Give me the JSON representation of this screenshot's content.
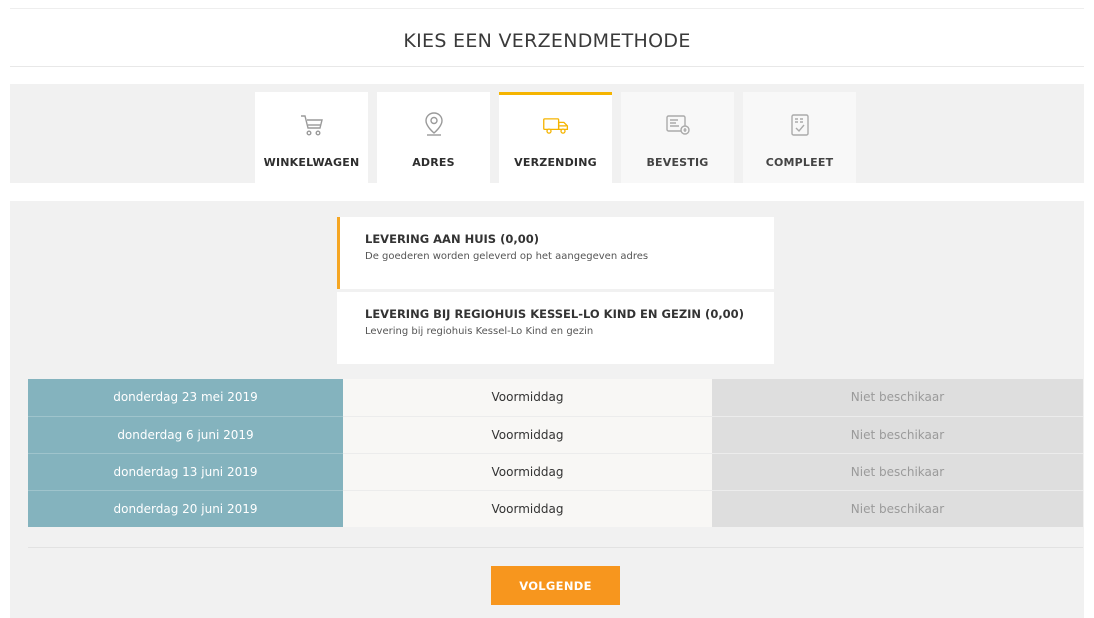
{
  "page": {
    "title": "KIES EEN VERZENDMETHODE"
  },
  "steps": [
    {
      "label": "WINKELWAGEN",
      "icon": "cart-icon",
      "state": "done"
    },
    {
      "label": "ADRES",
      "icon": "location-pin-icon",
      "state": "done"
    },
    {
      "label": "VERZENDING",
      "icon": "truck-icon",
      "state": "active"
    },
    {
      "label": "BEVESTIG",
      "icon": "payment-card-icon",
      "state": "upcoming"
    },
    {
      "label": "COMPLEET",
      "icon": "checklist-icon",
      "state": "upcoming"
    }
  ],
  "shipping_options": [
    {
      "title": "LEVERING AAN HUIS (0,00)",
      "description": "De goederen worden geleverd op het aangegeven adres",
      "selected": true
    },
    {
      "title": "LEVERING BIJ REGIOHUIS KESSEL-LO KIND EN GEZIN (0,00)",
      "description": "Levering bij regiohuis Kessel-Lo Kind en gezin",
      "selected": false
    }
  ],
  "delivery_slots": [
    {
      "date": "donderdag 23 mei 2019",
      "time": "Voormiddag",
      "status": "Niet beschikaar"
    },
    {
      "date": "donderdag 6 juni 2019",
      "time": "Voormiddag",
      "status": "Niet beschikaar"
    },
    {
      "date": "donderdag 13 juni 2019",
      "time": "Voormiddag",
      "status": "Niet beschikaar"
    },
    {
      "date": "donderdag 20 juni 2019",
      "time": "Voormiddag",
      "status": "Niet beschikaar"
    }
  ],
  "actions": {
    "next_label": "VOLGENDE"
  },
  "colors": {
    "accent": "#f5b400",
    "button": "#f7961e",
    "date_cell": "#84b3be",
    "unavailable_cell": "#dedede"
  }
}
